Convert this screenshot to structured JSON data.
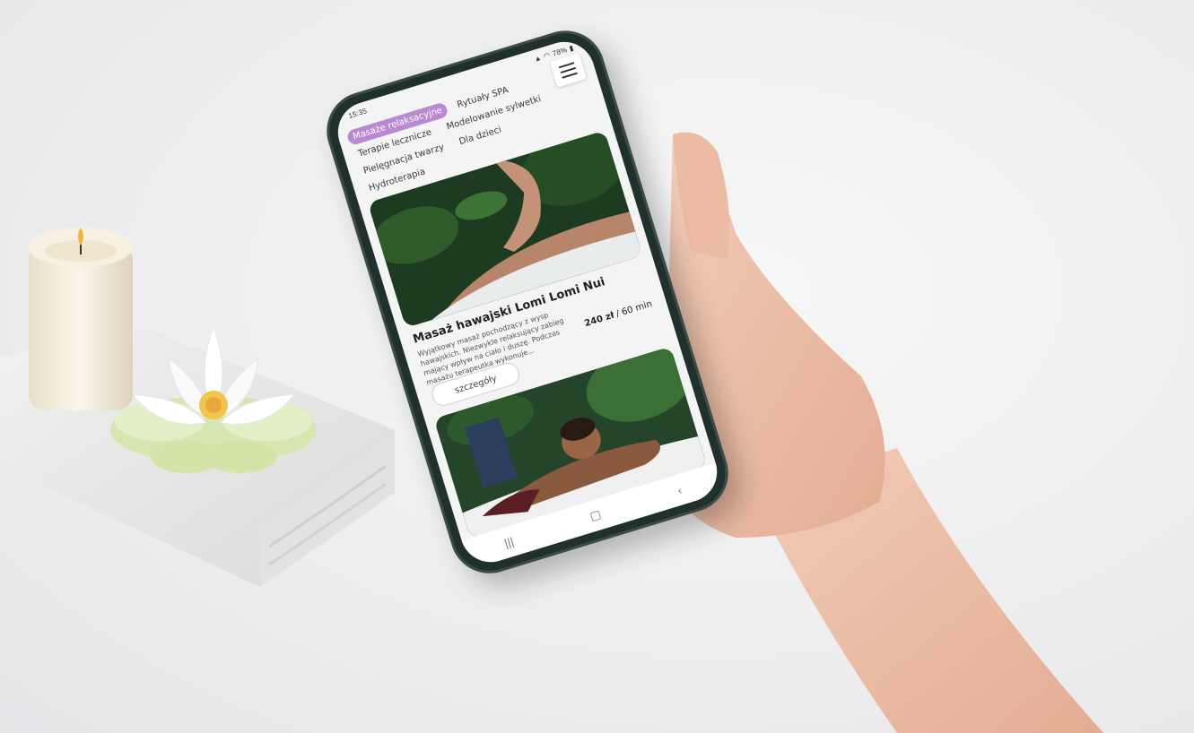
{
  "status_bar": {
    "time": "15:35",
    "battery": "78%"
  },
  "categories": [
    {
      "label": "Masaże relaksacyjne",
      "active": true
    },
    {
      "label": "Rytuały SPA",
      "active": false
    },
    {
      "label": "Terapie lecznicze",
      "active": false
    },
    {
      "label": "Modelowanie sylwetki",
      "active": false
    },
    {
      "label": "Pielęgnacja twarzy",
      "active": false
    },
    {
      "label": "Dla dzieci",
      "active": false
    },
    {
      "label": "Hydroterapia",
      "active": false
    }
  ],
  "card": {
    "title": "Masaż hawajski Lomi Lomi Nui",
    "description": "Wyjątkowy masaż pochodzący z wysp hawajskich. Niezwykle relaksujący zabieg mający wpływ na ciało i duszę. Podczas masażu terapeutka wykonuje...",
    "price": "240 zł",
    "separator": "/",
    "duration": "60 min",
    "details_label": "szczegóły"
  },
  "colors": {
    "accent": "#b98ad0",
    "phone_body": "#20312c"
  },
  "icons": {
    "menu": "hamburger-icon",
    "nav_recent": "recent-apps-icon",
    "nav_home": "home-icon",
    "nav_back": "back-icon"
  }
}
